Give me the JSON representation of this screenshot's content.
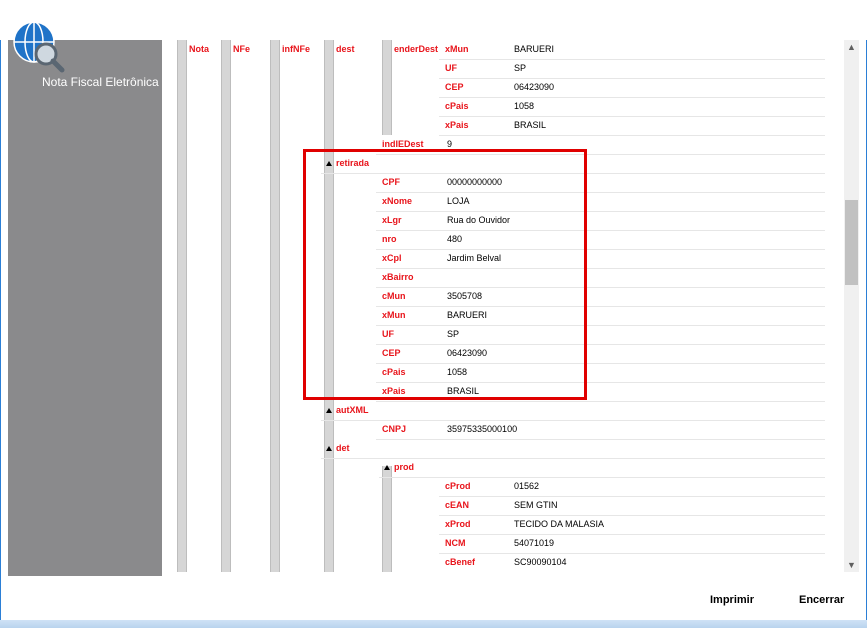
{
  "sidebar": {
    "app_name": "Nota Fiscal Eletrônica",
    "logo_icon": "globe-search-icon"
  },
  "tree": {
    "level_labels": [
      "Nota",
      "NFe",
      "infNFe",
      "dest",
      "enderDest"
    ],
    "enderDest": [
      {
        "k": "xMun",
        "v": "BARUERI"
      },
      {
        "k": "UF",
        "v": "SP"
      },
      {
        "k": "CEP",
        "v": "06423090"
      },
      {
        "k": "cPais",
        "v": "1058"
      },
      {
        "k": "xPais",
        "v": "BRASIL"
      }
    ],
    "indIEDest": {
      "k": "indIEDest",
      "v": "9"
    },
    "retirada_label": "retirada",
    "retirada": [
      {
        "k": "CPF",
        "v": "00000000000"
      },
      {
        "k": "xNome",
        "v": "LOJA"
      },
      {
        "k": "xLgr",
        "v": "Rua do Ouvidor"
      },
      {
        "k": "nro",
        "v": "480"
      },
      {
        "k": "xCpl",
        "v": "Jardim Belval"
      },
      {
        "k": "xBairro",
        "v": ""
      },
      {
        "k": "cMun",
        "v": "3505708"
      },
      {
        "k": "xMun",
        "v": "BARUERI"
      },
      {
        "k": "UF",
        "v": "SP"
      },
      {
        "k": "CEP",
        "v": "06423090"
      },
      {
        "k": "cPais",
        "v": "1058"
      },
      {
        "k": "xPais",
        "v": "BRASIL"
      }
    ],
    "autXML_label": "autXML",
    "autXML": [
      {
        "k": "CNPJ",
        "v": "35975335000100"
      }
    ],
    "det_label": "det",
    "prod_label": "prod",
    "prod": [
      {
        "k": "cProd",
        "v": "01562"
      },
      {
        "k": "cEAN",
        "v": "SEM GTIN"
      },
      {
        "k": "xProd",
        "v": "TECIDO DA MALASIA"
      },
      {
        "k": "NCM",
        "v": "54071019"
      },
      {
        "k": "cBenef",
        "v": "SC90090104"
      }
    ]
  },
  "footer": {
    "print_label": "Imprimir",
    "close_label": "Encerrar"
  },
  "colors": {
    "key": "#e8141b",
    "highlight": "#e00000",
    "sidebar": "#8a8a8c"
  }
}
